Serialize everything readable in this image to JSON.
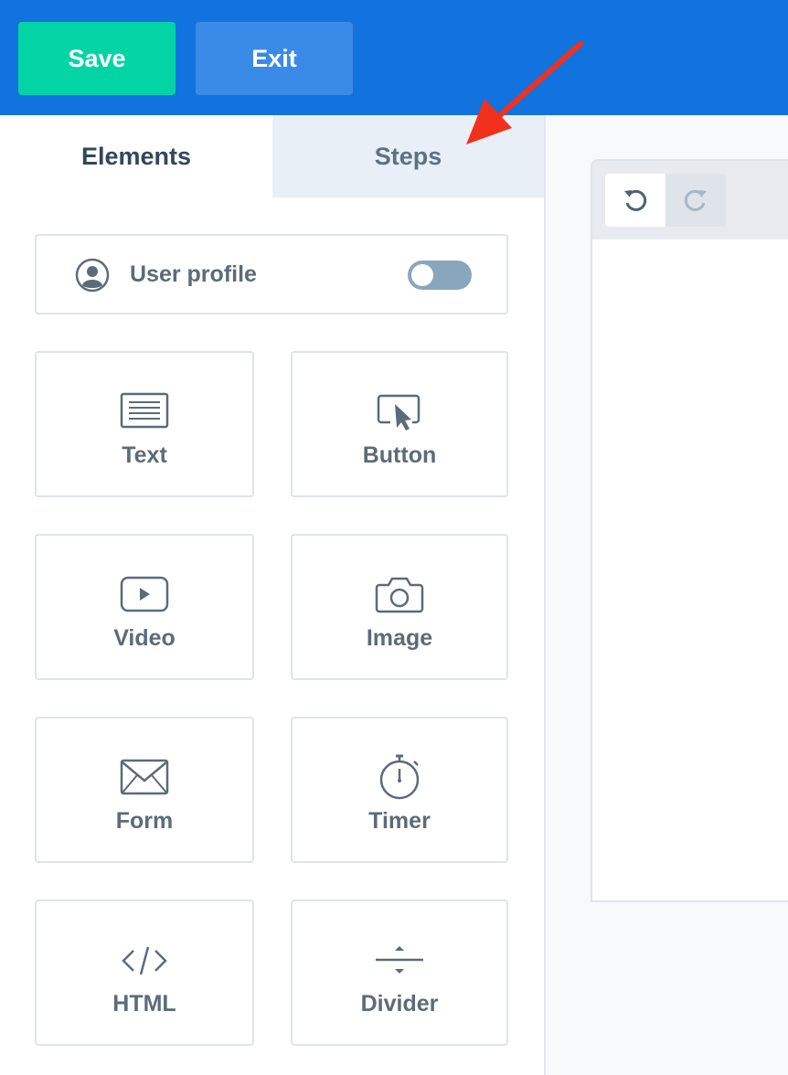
{
  "toolbar": {
    "save_label": "Save",
    "exit_label": "Exit"
  },
  "tabs": [
    {
      "label": "Elements",
      "active": true
    },
    {
      "label": "Steps",
      "active": false
    }
  ],
  "user_profile": {
    "label": "User profile",
    "icon": "user-circle-icon",
    "toggle_on": false
  },
  "elements": [
    {
      "label": "Text",
      "icon": "text-icon"
    },
    {
      "label": "Button",
      "icon": "cursor-click-icon"
    },
    {
      "label": "Video",
      "icon": "play-icon"
    },
    {
      "label": "Image",
      "icon": "camera-icon"
    },
    {
      "label": "Form",
      "icon": "envelope-icon"
    },
    {
      "label": "Timer",
      "icon": "stopwatch-icon"
    },
    {
      "label": "HTML",
      "icon": "code-icon"
    },
    {
      "label": "Divider",
      "icon": "divider-icon"
    }
  ],
  "canvas": {
    "undo_icon": "undo-icon",
    "redo_icon": "redo-icon"
  },
  "colors": {
    "topbar": "#1273de",
    "save_button": "#03d4a6",
    "exit_button": "#3a8be8",
    "tab_inactive": "#e9eff6",
    "annotation_arrow": "#f2311c"
  }
}
